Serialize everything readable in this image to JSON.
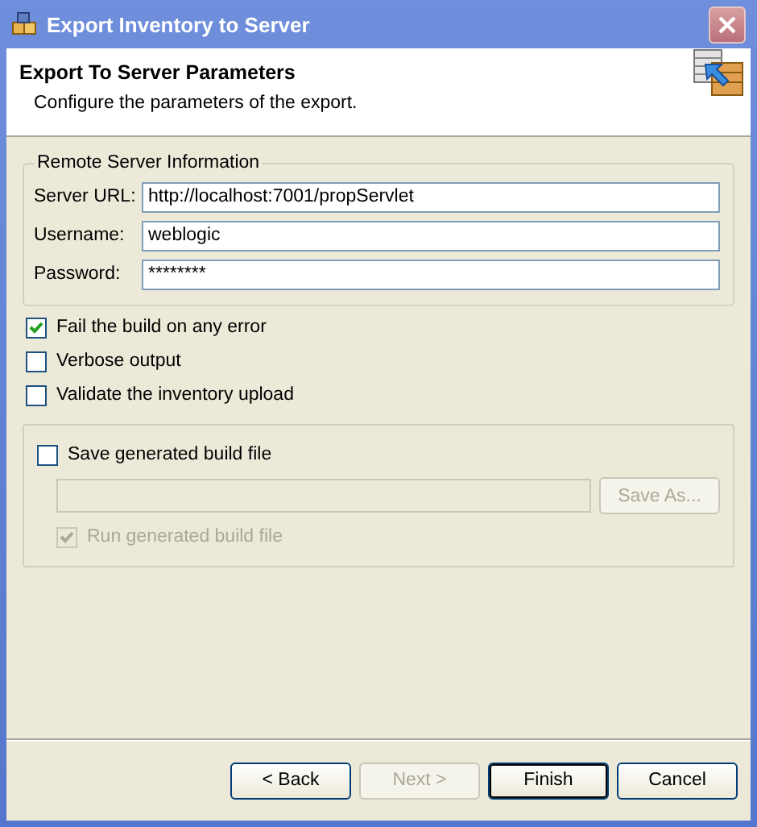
{
  "window": {
    "title": "Export Inventory to Server"
  },
  "header": {
    "title": "Export To Server Parameters",
    "description": "Configure the parameters of the export."
  },
  "server_group": {
    "title": "Remote Server Information",
    "fields": [
      {
        "label": "Server URL:",
        "value": "http://localhost:7001/propServlet"
      },
      {
        "label": "Username:",
        "value": "weblogic"
      },
      {
        "label": "Password:",
        "value": "********"
      }
    ]
  },
  "options": [
    {
      "label": "Fail the build on any error",
      "checked": true,
      "disabled": false
    },
    {
      "label": "Verbose output",
      "checked": false,
      "disabled": false
    },
    {
      "label": "Validate the inventory upload",
      "checked": false,
      "disabled": false
    }
  ],
  "save_group": {
    "save_checkbox": {
      "label": "Save generated build file",
      "checked": false,
      "disabled": false
    },
    "path_field": {
      "disabled": true
    },
    "save_as_button": {
      "label": "Save As...",
      "disabled": true
    },
    "run_checkbox": {
      "label": "Run generated build file",
      "checked": true,
      "disabled": true
    }
  },
  "buttons": [
    {
      "label": "< Back",
      "disabled": false,
      "default": false
    },
    {
      "label": "Next >",
      "disabled": true,
      "default": false
    },
    {
      "label": "Finish",
      "disabled": false,
      "default": true
    },
    {
      "label": "Cancel",
      "disabled": false,
      "default": false
    }
  ]
}
